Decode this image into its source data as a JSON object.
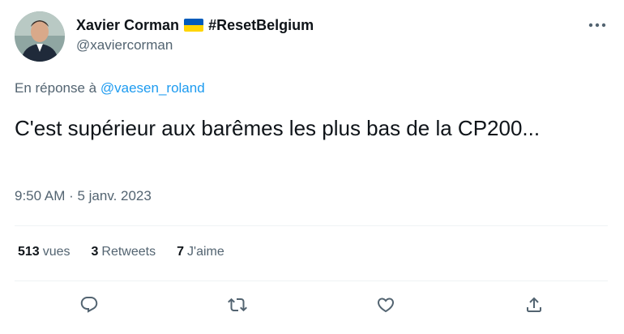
{
  "author": {
    "display_name": "Xavier Corman",
    "flag_icon": "ukraine-flag-icon",
    "hashtag": "#ResetBelgium",
    "handle": "@xaviercorman"
  },
  "reply": {
    "prefix": "En réponse à",
    "mention": "@vaesen_roland"
  },
  "tweet": {
    "text": "C'est supérieur aux barêmes les plus bas de la CP200...",
    "timestamp": "9:50 AM · 5 janv. 2023"
  },
  "stats": {
    "views_count": "513",
    "views_label": "vues",
    "retweets_count": "3",
    "retweets_label": "Retweets",
    "likes_count": "7",
    "likes_label": "J'aime"
  },
  "actions": {
    "reply_icon": "reply-icon",
    "retweet_icon": "retweet-icon",
    "like_icon": "heart-icon",
    "share_icon": "share-icon",
    "more_icon": "more-icon"
  },
  "colors": {
    "link": "#1d9bf0",
    "secondary_text": "#536471",
    "primary_text": "#0f1419",
    "flag_blue": "#005bbb",
    "flag_yellow": "#ffd500"
  }
}
